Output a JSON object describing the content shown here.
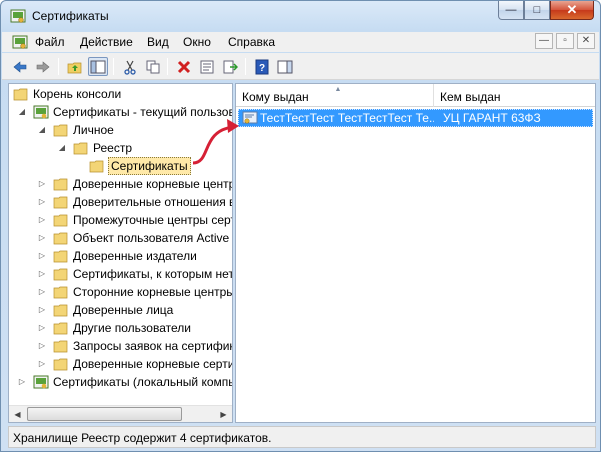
{
  "window": {
    "title": "Сертификаты",
    "min": "—",
    "max": "□",
    "close": "✕"
  },
  "menu": {
    "items": [
      {
        "label": "Файл"
      },
      {
        "label": "Действие"
      },
      {
        "label": "Вид"
      },
      {
        "label": "Окно"
      },
      {
        "label": "Справка"
      }
    ],
    "mdi_min": "—",
    "mdi_restore": "▫",
    "mdi_close": "✕"
  },
  "tree": {
    "items": [
      {
        "label": "Корень консоли"
      },
      {
        "label": "Сертификаты - текущий пользователь"
      },
      {
        "label": "Личное"
      },
      {
        "label": "Реестр"
      },
      {
        "label": "Сертификаты"
      },
      {
        "label": "Доверенные корневые центры сертификации"
      },
      {
        "label": "Доверительные отношения в предприятии"
      },
      {
        "label": "Промежуточные центры сертификации"
      },
      {
        "label": "Объект пользователя Active Directory"
      },
      {
        "label": "Доверенные издатели"
      },
      {
        "label": "Сертификаты, к которым нет доверия"
      },
      {
        "label": "Сторонние корневые центры сертификации"
      },
      {
        "label": "Доверенные лица"
      },
      {
        "label": "Другие пользователи"
      },
      {
        "label": "Запросы заявок на сертификат"
      },
      {
        "label": "Доверенные корневые сертификаты смарт-карты"
      },
      {
        "label": "Сертификаты (локальный компьютер)"
      }
    ]
  },
  "list": {
    "columns": [
      {
        "label": "Кому выдан"
      },
      {
        "label": "Кем выдан"
      }
    ],
    "rows": [
      {
        "issued_to": "ТестТестТест ТестТестТест Те...",
        "issued_by": "УЦ ГАРАНТ 63ФЗ"
      }
    ]
  },
  "status": {
    "text": "Хранилище Реестр содержит 4 сертификатов."
  },
  "colors": {
    "selection": "#3399ff",
    "annotation_arrow": "#d62035"
  }
}
